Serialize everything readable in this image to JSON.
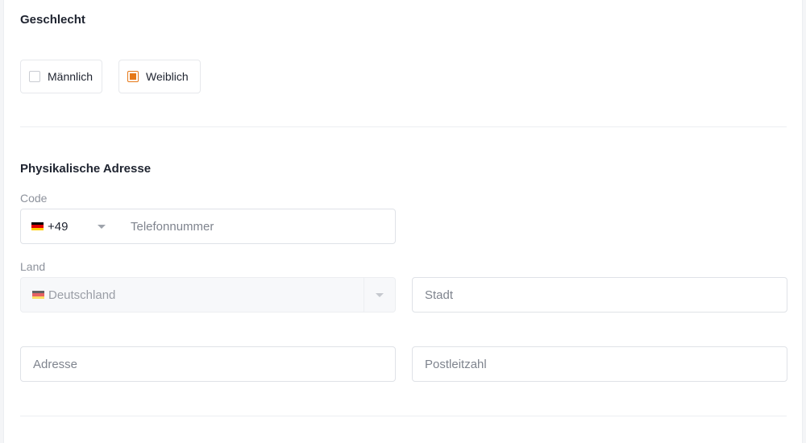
{
  "gender": {
    "title": "Geschlecht",
    "options": [
      {
        "label": "Männlich",
        "checked": false
      },
      {
        "label": "Weiblich",
        "checked": true
      }
    ]
  },
  "address": {
    "title": "Physikalische Adresse",
    "code_label": "Code",
    "dial_code": "+49",
    "phone_placeholder": "Telefonnummer",
    "country_label": "Land",
    "country_value": "Deutschland",
    "city_placeholder": "Stadt",
    "street_placeholder": "Adresse",
    "postal_placeholder": "Postleitzahl"
  },
  "colors": {
    "accent": "#e67817",
    "flag_black": "#000000",
    "flag_red": "#dd0000",
    "flag_gold": "#ffce00"
  },
  "icons": {
    "flag": "germany-flag-icon",
    "dropdown": "caret-down-icon"
  }
}
